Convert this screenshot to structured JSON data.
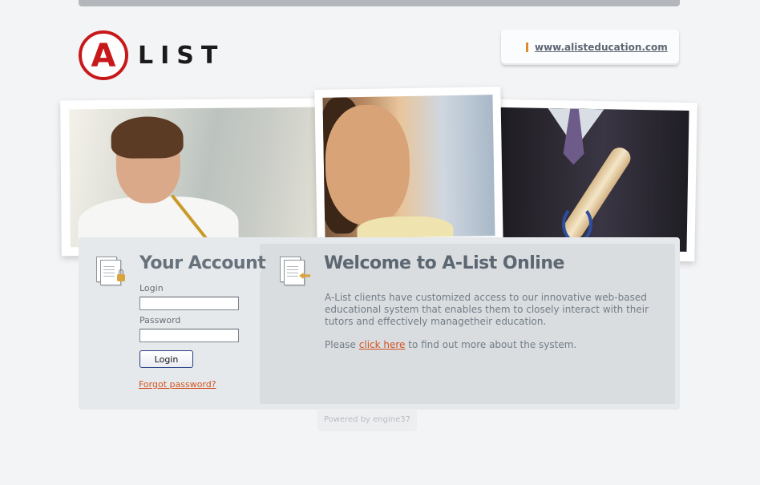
{
  "brand": {
    "logo_letter": "A",
    "logo_word": "LIST",
    "brand_color": "#c8191a",
    "website_link": "www.alisteducation.com"
  },
  "hero": {
    "photos": [
      "student-with-pencil-photo",
      "smiling-girl-photo",
      "graduate-with-diploma-photo"
    ]
  },
  "account": {
    "title": "Your Account",
    "login_label": "Login",
    "login_value": "",
    "password_label": "Password",
    "password_value": "",
    "login_button": "Login",
    "forgot_link": "Forgot password?",
    "icon": "secure-document-icon"
  },
  "welcome": {
    "title": "Welcome to A-List Online",
    "body": "A-List clients have customized access to our innovative web-based educational system that enables them to closely interact with their tutors and effectively managetheir education.",
    "more_prefix": "Please ",
    "more_link": "click here",
    "more_suffix": " to find out more about the system.",
    "icon": "document-arrow-icon"
  },
  "footer": {
    "powered_by": "Powered by engine37"
  },
  "colors": {
    "accent_link": "#d2521f",
    "panel_bg": "#e6e9eb",
    "welcome_bg": "#d9dde0"
  }
}
